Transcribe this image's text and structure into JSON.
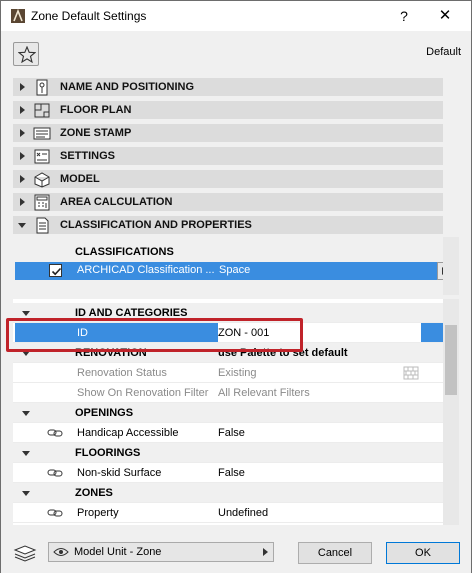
{
  "window": {
    "title": "Zone Default Settings",
    "help_label": "?",
    "close_label": "✕"
  },
  "toolbar": {
    "favorites_icon": "star-icon",
    "default_label": "Default"
  },
  "panels": [
    {
      "label": "NAME AND POSITIONING",
      "icon": "name-positioning-icon",
      "expanded": false
    },
    {
      "label": "FLOOR PLAN",
      "icon": "floor-plan-icon",
      "expanded": false
    },
    {
      "label": "ZONE STAMP",
      "icon": "zone-stamp-icon",
      "expanded": false
    },
    {
      "label": "SETTINGS",
      "icon": "settings-icon",
      "expanded": false
    },
    {
      "label": "MODEL",
      "icon": "model-icon",
      "expanded": false
    },
    {
      "label": "AREA CALCULATION",
      "icon": "area-calculation-icon",
      "expanded": false
    },
    {
      "label": "CLASSIFICATION AND PROPERTIES",
      "icon": "classification-icon",
      "expanded": true
    }
  ],
  "classifications": {
    "header": "CLASSIFICATIONS",
    "row": {
      "name": "ARCHICAD Classification ...",
      "value": "Space",
      "checked": true
    }
  },
  "properties": {
    "groups": [
      {
        "name": "ID AND CATEGORIES",
        "value": ""
      },
      {
        "name": "RENOVATION",
        "value": "use Palette to set default"
      },
      {
        "name": "OPENINGS",
        "value": ""
      },
      {
        "name": "FLOORINGS",
        "value": ""
      },
      {
        "name": "ZONES",
        "value": ""
      }
    ],
    "rows": [
      {
        "name": "ID",
        "value": "ZON - 001"
      },
      {
        "name": "Renovation Status",
        "value": "Existing"
      },
      {
        "name": "Show On Renovation Filter",
        "value": "All Relevant Filters"
      },
      {
        "name": "Handicap Accessible",
        "value": "False"
      },
      {
        "name": "Non-skid Surface",
        "value": "False"
      },
      {
        "name": "Property",
        "value": "Undefined"
      }
    ]
  },
  "footer": {
    "model_unit_label": "Model Unit - Zone",
    "cancel_label": "Cancel",
    "ok_label": "OK"
  },
  "colors": {
    "selection": "#3a8de0",
    "highlight_frame": "#c0232a",
    "panel_header": "#dcdcdc"
  }
}
